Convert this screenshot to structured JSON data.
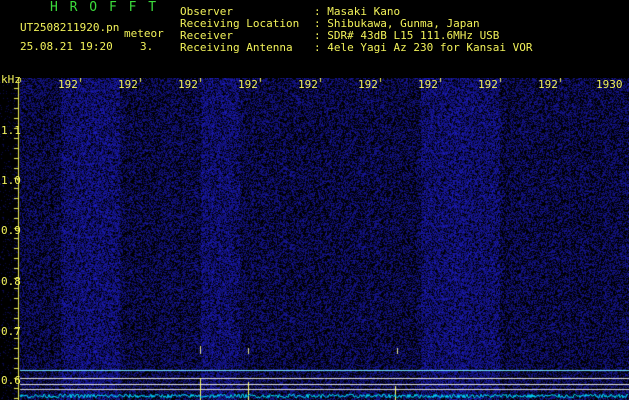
{
  "app": {
    "title": "H R O F F T",
    "filename": "UT2508211920.pn",
    "mode": "meteor",
    "datetime": "25.08.21 19:20",
    "count": "3."
  },
  "info": {
    "labels": [
      "Observer",
      "Receiving Location",
      "Receiver",
      "Receiving Antenna"
    ],
    "values": [
      ": Masaki Kano",
      ": Shibukawa, Gunma, Japan",
      ": SDR# 43dB L15 111.6MHz USB",
      ": 4ele Yagi Az 230 for Kansai VOR"
    ]
  },
  "axes": {
    "unit": "kHz",
    "time_ticks": [
      "192",
      "192",
      "192",
      "192",
      "192",
      "192",
      "192",
      "192",
      "192",
      "1930"
    ],
    "freq_ticks": [
      "1.1",
      "1.0",
      "0.9",
      "0.8",
      "0.7",
      "0.6"
    ]
  },
  "colors": {
    "background": "#000000",
    "text": "#f2f25a",
    "title": "#3cdc3c",
    "noise": "#1a1aa0",
    "signal": "#ffff66",
    "trace": "#00e0ff"
  }
}
